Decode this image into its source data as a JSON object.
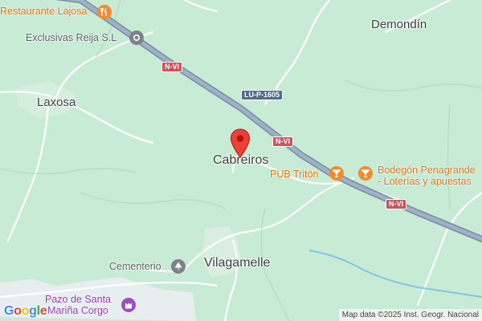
{
  "map": {
    "places": {
      "demondin": "Demondín",
      "laxosa": "Laxosa",
      "cabreiros": "Cabreiros",
      "vilagamelle": "Vilagamelle"
    },
    "pois": {
      "restaurante": "Restaurante Lajosa",
      "exclusivas": "Exclusivas Reija S.L",
      "pub": "PUB Tritón",
      "bodegon_line1": "Bodegón Penagrande",
      "bodegon_line2": "- Loterías y apuestas",
      "cementerio": "Cementerio",
      "pazo_line1": "Pazo de Santa",
      "pazo_line2": "Mariña Corgo"
    },
    "road_labels": {
      "nvi_1": "N-VI",
      "nvi_2": "N-VI",
      "nvi_3": "N-VI",
      "lup": "LU-P-1605"
    },
    "attribution": "Map data ©2025 Inst. Geogr. Nacional",
    "logo": {
      "letters": [
        "G",
        "o",
        "o",
        "g",
        "l",
        "e"
      ],
      "colors": [
        "#4285F4",
        "#EA4335",
        "#FBBC05",
        "#4285F4",
        "#34A853",
        "#EA4335"
      ]
    },
    "colors": {
      "land": "#c8ebd5",
      "highway": "#8a9bb0",
      "minor_road": "#ffffff",
      "water": "#7fc6e8",
      "marker": "#ea4335",
      "poi_orange": "#f28b30",
      "poi_gray": "#7d8388",
      "poi_purple": "#9c4fc3"
    }
  }
}
